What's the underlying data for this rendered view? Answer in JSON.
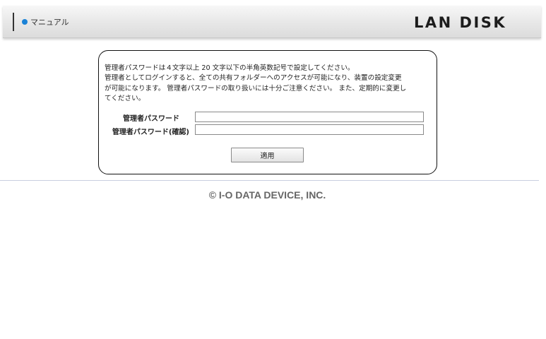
{
  "header": {
    "manual_label": "マニュアル",
    "logo_text": "LAN DISK",
    "accent_color": "#1a82d6"
  },
  "panel": {
    "instructions": [
      "管理者パスワードは４文字以上 20 文字以下の半角英数記号で設定してください。",
      "管理者としてログインすると、全ての共有フォルダーへのアクセスが可能になり、装置の設定変更",
      "が可能になります。 管理者パスワードの取り扱いには十分ご注意ください。 また、定期的に変更し",
      "てください。"
    ],
    "password_label": "管理者パスワード",
    "password_value": "",
    "confirm_label": "管理者パスワード(確認)",
    "confirm_value": "",
    "apply_label": "適用"
  },
  "footer": {
    "copyright": "© I-O DATA DEVICE, INC."
  }
}
